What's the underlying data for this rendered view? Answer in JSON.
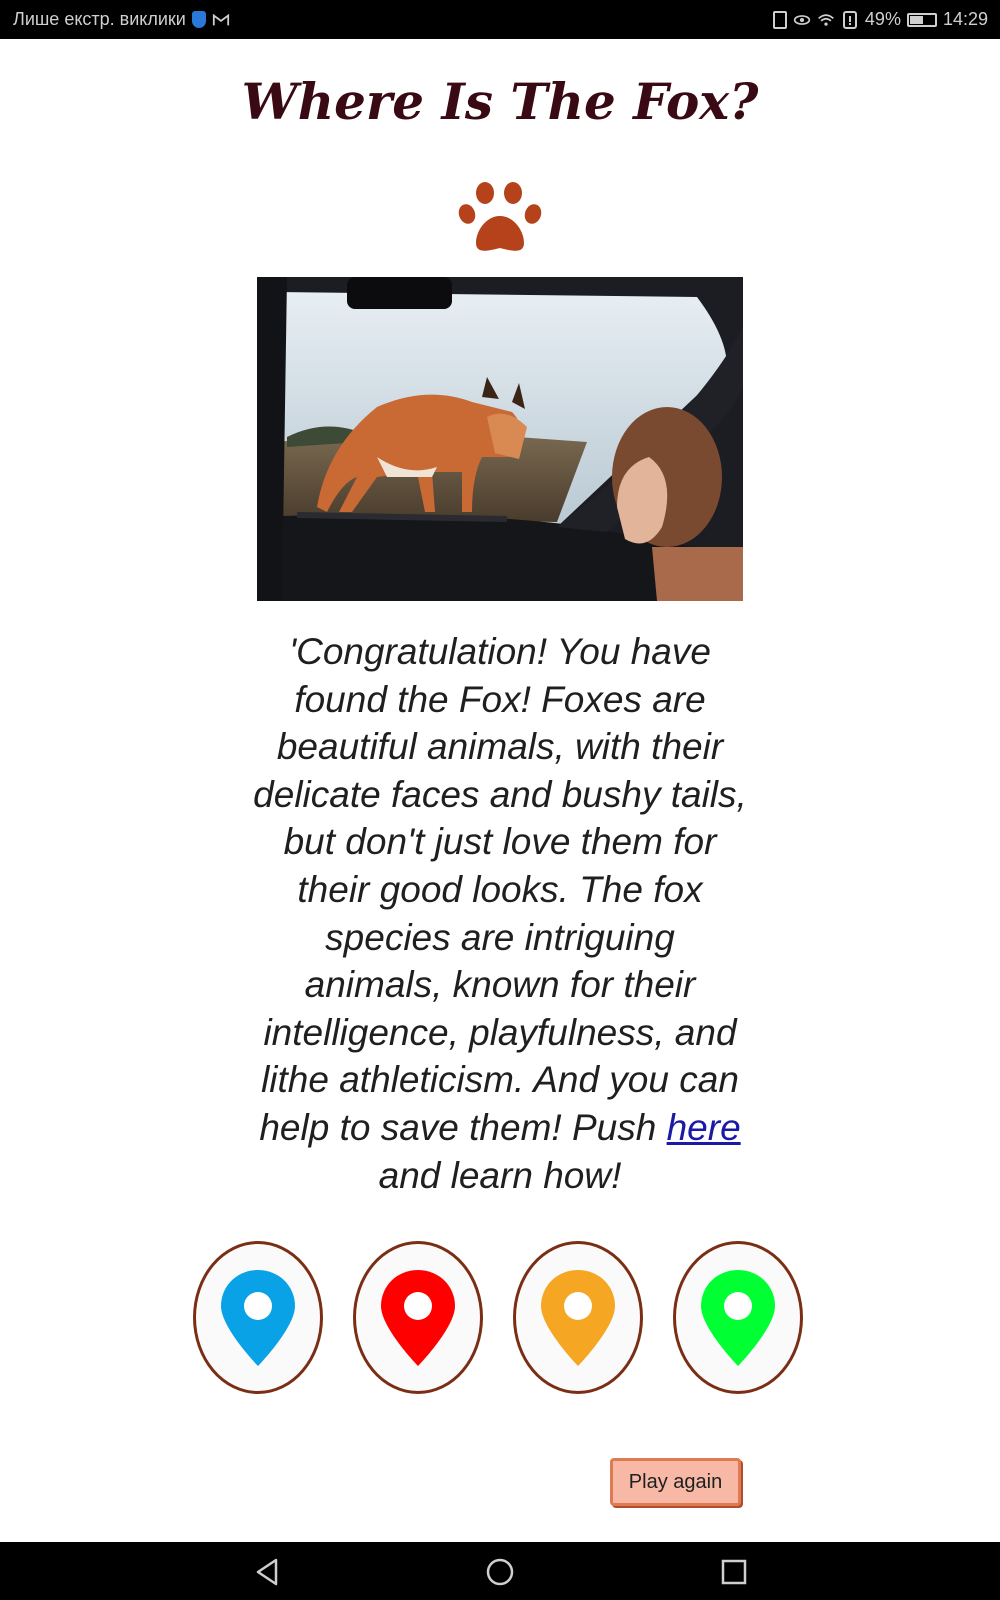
{
  "status_bar": {
    "carrier_text": "Лише екстр. виклики",
    "battery_percent": "49%",
    "time": "14:29",
    "icons": [
      "shield-icon",
      "gmail-icon",
      "vibrate-icon",
      "eye-icon",
      "wifi-icon",
      "sim-alert-icon",
      "battery-icon"
    ]
  },
  "page": {
    "title": "Where Is The Fox?",
    "paw_color": "#b5421a",
    "message_before_link": "'Congratulation! You have found the Fox! Foxes are beautiful animals, with their delicate faces and bushy tails, but don't just love them for their good looks. The fox species are intriguing animals, known for their intelligence, playfulness, and lithe athleticism. And you can help to save them! Push ",
    "link_text": "here",
    "message_after_link": " and learn how!"
  },
  "pins": [
    {
      "name": "blue",
      "color": "#0aa2e6"
    },
    {
      "name": "red",
      "color": "#ff0000"
    },
    {
      "name": "orange",
      "color": "#f5a623"
    },
    {
      "name": "green",
      "color": "#00ff33"
    }
  ],
  "play_again_label": "Play again",
  "nav": {
    "icons": [
      "back-icon",
      "home-icon",
      "recents-icon"
    ]
  }
}
